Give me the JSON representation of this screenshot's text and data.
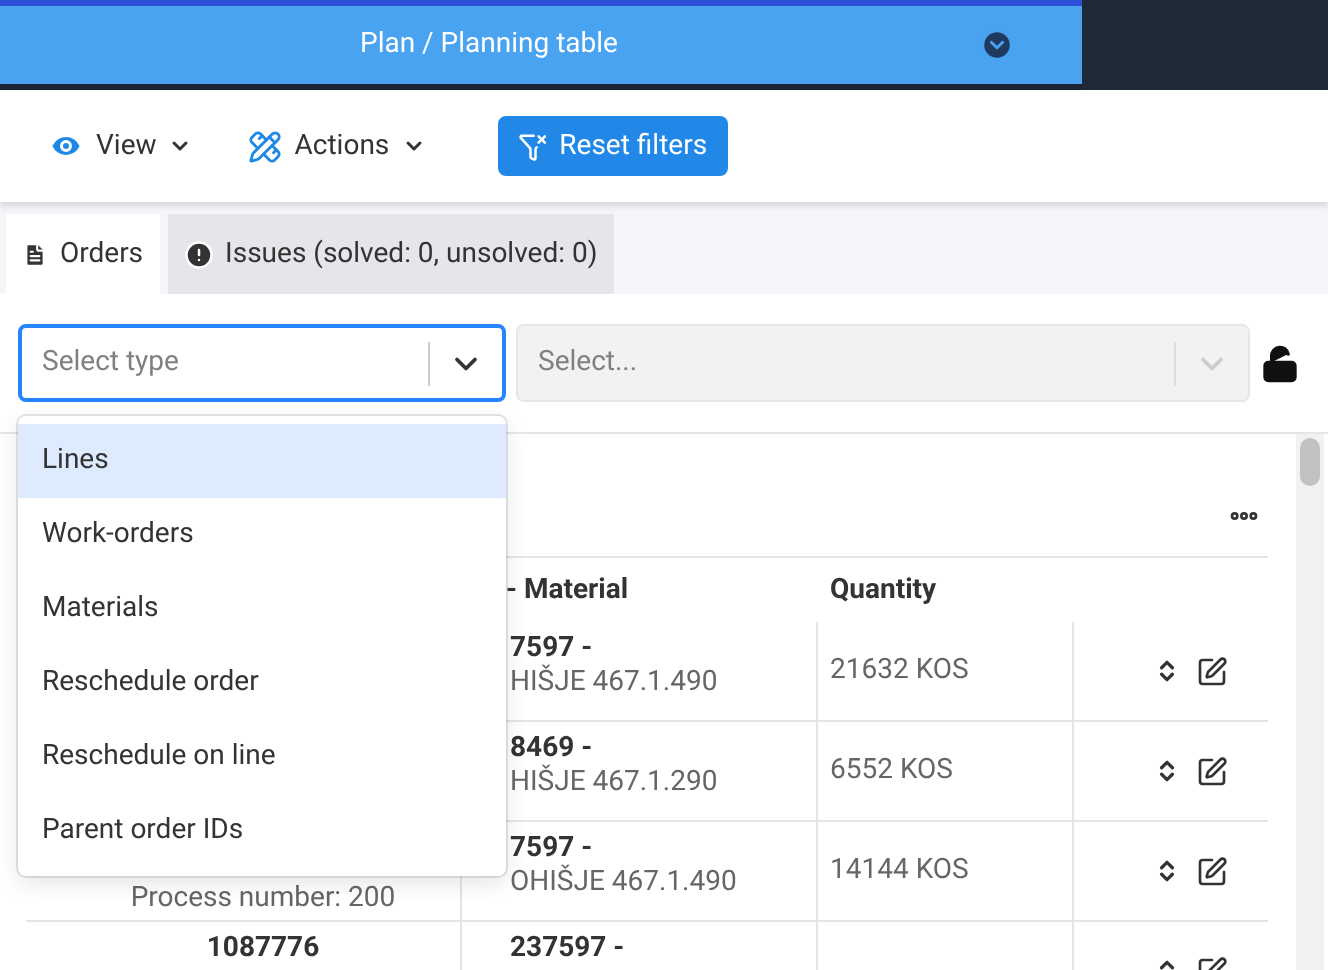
{
  "header": {
    "title": "Plan / Planning table"
  },
  "toolbar": {
    "menus": [
      {
        "kind": "view",
        "label": "View"
      },
      {
        "kind": "actions",
        "label": "Actions"
      }
    ],
    "reset_button": "Reset filters"
  },
  "tabs": [
    {
      "kind": "orders",
      "label": "Orders",
      "selected": true
    },
    {
      "kind": "issues",
      "label": "Issues (solved: 0, unsolved: 0)",
      "selected": false
    }
  ],
  "filters": {
    "type_select": {
      "placeholder": "Select type",
      "expanded": true
    },
    "value_select": {
      "placeholder": "Select...",
      "disabled": true
    },
    "locked": false
  },
  "type_options": [
    {
      "label": "Lines",
      "selected": true
    },
    {
      "label": "Work-orders",
      "selected": false
    },
    {
      "label": "Materials",
      "selected": false
    },
    {
      "label": "Reschedule order",
      "selected": false
    },
    {
      "label": "Reschedule on line",
      "selected": false
    },
    {
      "label": "Parent order IDs",
      "selected": false
    }
  ],
  "table": {
    "columns": [
      "- Material",
      "Quantity"
    ],
    "rows": [
      {
        "column_1": [],
        "material": [
          "7597 -",
          "HIŠJE 467.1.490"
        ],
        "quantity": "21632 KOS"
      },
      {
        "column_1": [],
        "material": [
          "8469 -",
          "HIŠJE 467.1.290"
        ],
        "quantity": "6552 KOS"
      },
      {
        "column_1": [
          {
            "kind": "detail",
            "text": "Process number: 200"
          }
        ],
        "material": [
          "7597 -",
          "OHIŠJE 467.1.490"
        ],
        "quantity": "14144 KOS"
      },
      {
        "column_1": [
          {
            "kind": "id",
            "text": "1087776"
          }
        ],
        "material": [
          "237597 -"
        ],
        "quantity": ""
      }
    ]
  }
}
